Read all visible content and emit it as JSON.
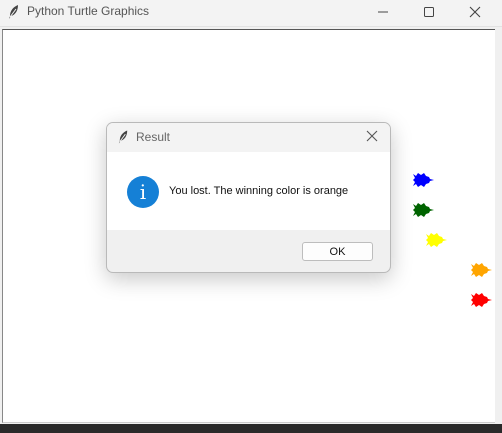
{
  "window": {
    "title": "Python Turtle Graphics",
    "icon": "feather-icon",
    "controls": [
      "minimize-icon",
      "maximize-icon",
      "close-icon"
    ]
  },
  "turtles": [
    {
      "name": "blue",
      "color": "#0000ff"
    },
    {
      "name": "green",
      "color": "#006400"
    },
    {
      "name": "yellow",
      "color": "#ffff00"
    },
    {
      "name": "orange",
      "color": "#ffa500"
    },
    {
      "name": "red",
      "color": "#ff0000"
    }
  ],
  "dialog": {
    "title": "Result",
    "icon": "info-icon",
    "info_glyph": "i",
    "message": "You lost. The winning color is orange",
    "ok_label": "OK"
  }
}
